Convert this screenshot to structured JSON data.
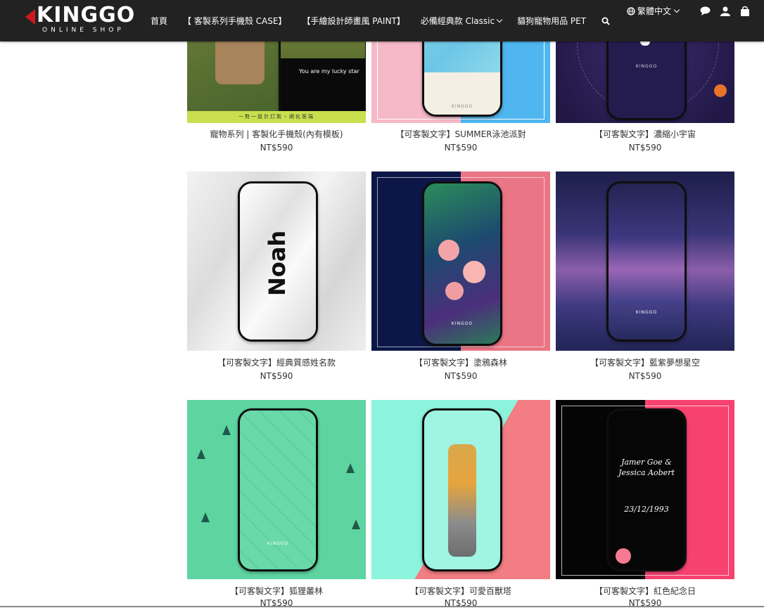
{
  "brand": {
    "name": "KINGGO",
    "tagline": "ONLINE SHOP",
    "accent": "#d0171f"
  },
  "nav": {
    "items": [
      {
        "label": "首頁"
      },
      {
        "label": "【 客製系列手機殼 CASE】"
      },
      {
        "label": "【手繪設計師畫風 PAINT】"
      },
      {
        "label": "必備經典款 Classic",
        "dropdown": true
      },
      {
        "label": "貓狗寵物用品 PET"
      }
    ],
    "search_icon": "search-icon"
  },
  "tools": {
    "language": "繁體中文",
    "icons": [
      "globe-icon",
      "chat-icon",
      "user-icon",
      "cart-icon"
    ]
  },
  "products": [
    {
      "name": "寵物系列 | 客製化手機殼(內有模板)",
      "price": "NT$590",
      "overlay_text": "You are my lucky star",
      "banner": "一對一設計訂製・網化客端"
    },
    {
      "name": "【可客製文字】SUMMER泳池派對",
      "price": "NT$590",
      "phone_brand": "KINGGO"
    },
    {
      "name": "【可客製文字】濃縮小宇宙",
      "price": "NT$590",
      "phone_brand": "KINGGO"
    },
    {
      "name": "【可客製文字】經典質感姓名款",
      "price": "NT$590",
      "phone_text": "Noah"
    },
    {
      "name": "【可客製文字】塗鴉森林",
      "price": "NT$590",
      "phone_brand": "KINGGO"
    },
    {
      "name": "【可客製文字】藍紫夢想星空",
      "price": "NT$590",
      "phone_brand": "KINGGO"
    },
    {
      "name": "【可客製文字】狐狸叢林",
      "price": "NT$590",
      "phone_brand": "KINGGO"
    },
    {
      "name": "【可客製文字】可愛百獸塔",
      "price": "NT$590"
    },
    {
      "name": "【可客製文字】紅色紀念日",
      "price": "NT$590",
      "phone_text": "Jamer Goe & Jessica Aobert",
      "phone_date": "23/12/1993"
    }
  ]
}
